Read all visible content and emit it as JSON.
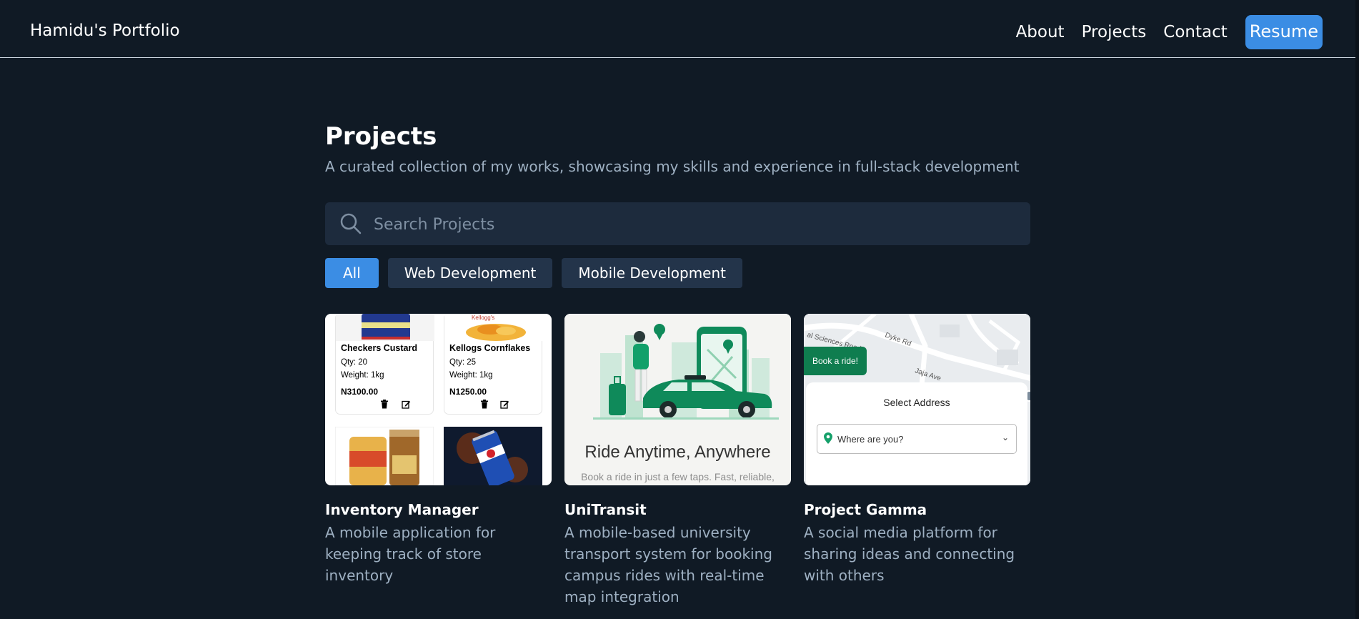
{
  "header": {
    "brand": "Hamidu's Portfolio",
    "nav": [
      {
        "label": "About"
      },
      {
        "label": "Projects"
      },
      {
        "label": "Contact"
      }
    ],
    "resume_label": "Resume"
  },
  "page": {
    "title": "Projects",
    "subtitle": "A curated collection of my works, showcasing my skills and experience in full-stack development"
  },
  "search": {
    "placeholder": "Search Projects",
    "value": ""
  },
  "filters": [
    {
      "label": "All",
      "active": true
    },
    {
      "label": "Web Development",
      "active": false
    },
    {
      "label": "Mobile Development",
      "active": false
    }
  ],
  "projects": [
    {
      "title": "Inventory Manager",
      "description": "A mobile application for keeping track of store inventory",
      "thumbnail": {
        "products": [
          {
            "name": "Checkers Custard",
            "qty": "Qty: 20",
            "weight": "Weight: 1kg",
            "price": "N3100.00"
          },
          {
            "name": "Kellogs Cornflakes",
            "qty": "Qty: 25",
            "weight": "Weight: 1kg",
            "price": "N1250.00"
          }
        ]
      }
    },
    {
      "title": "UniTransit",
      "description": "A mobile-based university transport system for booking campus rides with real-time map integration",
      "thumbnail": {
        "headline": "Ride Anytime, Anywhere",
        "subtext": "Book a ride in just a few taps. Fast, reliable,"
      }
    },
    {
      "title": "Project Gamma",
      "description": "A social media platform for sharing ideas and connecting with others",
      "thumbnail": {
        "book_button": "Book a ride!",
        "sheet_title": "Select Address",
        "address_placeholder": "Where are you?",
        "map_labels": [
          "al Sciences Road",
          "Dyke Rd",
          "Jaja Ave"
        ]
      }
    }
  ],
  "colors": {
    "background": "#101a25",
    "accent": "#3b8de4",
    "chip": "#23344a",
    "search_bg": "#1d2b3d",
    "muted_text": "#9eb0c2",
    "brand_green": "#0f7d4f"
  }
}
